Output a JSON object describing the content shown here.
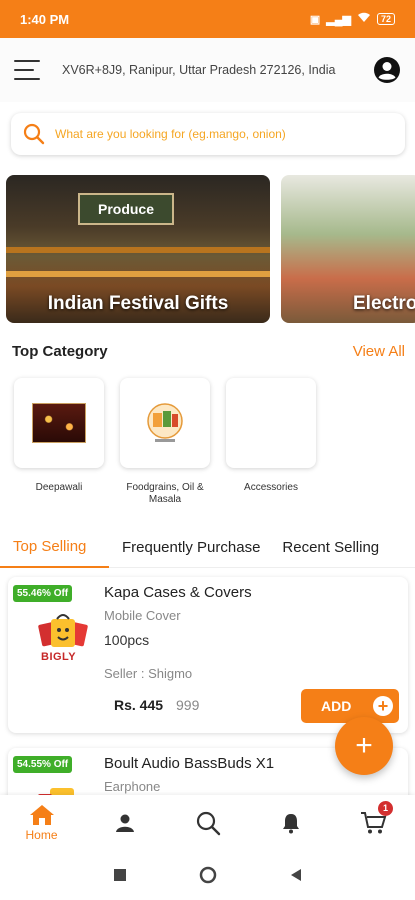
{
  "status_bar": {
    "time": "1:40 PM",
    "battery": "72"
  },
  "header": {
    "address": "XV6R+8J9, Ranipur, Uttar Pradesh 272126, India"
  },
  "search": {
    "placeholder": "What are you looking for (eg.mango, onion)"
  },
  "banners": [
    {
      "title": "Indian Festival Gifts",
      "sign": "Produce"
    },
    {
      "title": "Electro"
    }
  ],
  "top_category": {
    "title": "Top Category",
    "view_all": "View All",
    "items": [
      {
        "label": "Deepawali"
      },
      {
        "label": "Foodgrains, Oil & Masala"
      },
      {
        "label": "Accessories"
      }
    ]
  },
  "tabs": [
    "Top Selling",
    "Frequently Purchase",
    "Recent Selling"
  ],
  "products": [
    {
      "discount": "55.46% Off",
      "brand_logo_text": "BIGLY",
      "name": "Kapa Cases & Covers",
      "category": "Mobile Cover",
      "quantity": "100pcs",
      "seller": "Seller : Shigmo",
      "price": "Rs. 445",
      "mrp": "999",
      "add_label": "ADD"
    },
    {
      "discount": "54.55% Off",
      "name": "Boult Audio BassBuds X1",
      "category": "Earphone"
    }
  ],
  "bottom_nav": {
    "home_label": "Home",
    "cart_count": "1"
  },
  "colors": {
    "accent": "#f57f17",
    "discount_green": "#3fae29"
  }
}
